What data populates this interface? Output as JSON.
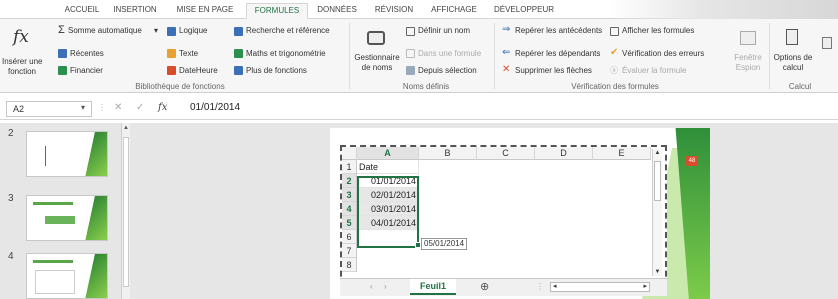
{
  "tabs": [
    "ACCUEIL",
    "INSERTION",
    "MISE EN PAGE",
    "FORMULES",
    "DONNÉES",
    "RÉVISION",
    "AFFICHAGE",
    "DÉVELOPPEUR"
  ],
  "active_tab": "FORMULES",
  "ribbon": {
    "insert_function": [
      "Insérer une",
      "fonction"
    ],
    "library": {
      "autosum": "Somme automatique",
      "recent": "Récentes",
      "financial": "Financier",
      "logical": "Logique",
      "text": "Texte",
      "datetime": "DateHeure",
      "lookup": "Recherche et référence",
      "math": "Maths et trigonométrie",
      "more": "Plus de fonctions",
      "group_label": "Bibliothèque de fonctions"
    },
    "names": {
      "manager": [
        "Gestionnaire",
        "de noms"
      ],
      "define": "Définir un nom",
      "use_in_formula": "Dans une formule",
      "from_selection": "Depuis sélection",
      "group_label": "Noms définis"
    },
    "audit": {
      "trace_precedents": "Repérer les antécédents",
      "trace_dependents": "Repérer les dépendants",
      "remove_arrows": "Supprimer les flèches",
      "show_formulas": "Afficher les formules",
      "error_check": "Vérification des erreurs",
      "evaluate": "Évaluer la formule",
      "watch": [
        "Fenêtre",
        "Espion"
      ],
      "group_label": "Vérification des formules"
    },
    "calc": {
      "options": [
        "Options de",
        "calcul"
      ],
      "group_label": "Calcul"
    }
  },
  "formula_bar": {
    "name_box": "A2",
    "fx": "fx",
    "value": "01/01/2014"
  },
  "slides": [
    "2",
    "3",
    "4"
  ],
  "sheet": {
    "columns": [
      "A",
      "B",
      "C",
      "D",
      "E"
    ],
    "rows": [
      "1",
      "2",
      "3",
      "4",
      "5",
      "6",
      "7",
      "8"
    ],
    "header_cell": "Date",
    "dates": [
      "01/01/2014",
      "02/01/2014",
      "03/01/2014",
      "04/01/2014"
    ],
    "fill_tooltip": "05/01/2014",
    "sheet_tab": "Feuil1",
    "badge": "48"
  },
  "colors": {
    "accent": "#217346",
    "slide_green": "#2f8f3a"
  }
}
